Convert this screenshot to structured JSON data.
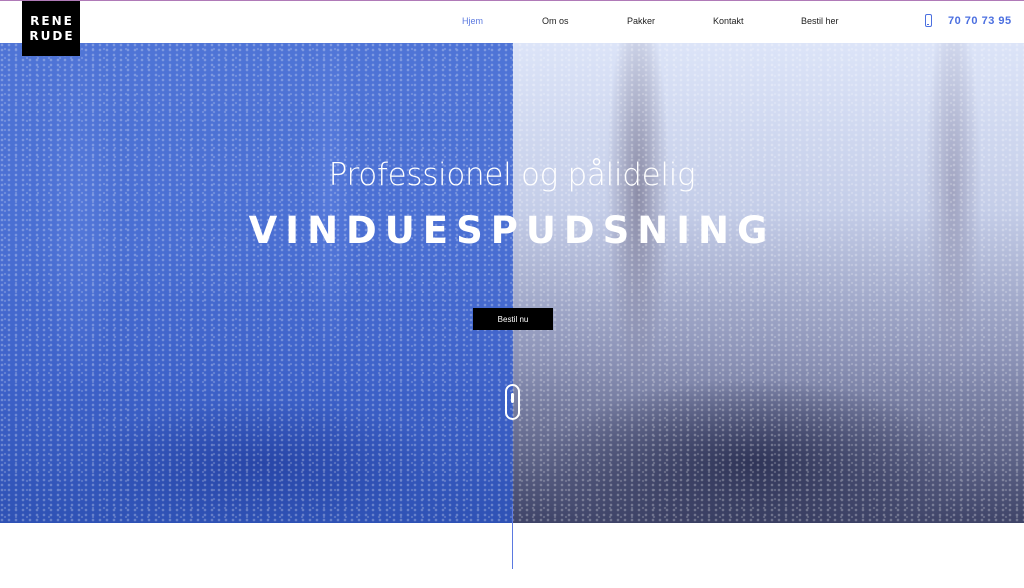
{
  "brand": {
    "logo_line1": "RENE",
    "logo_line2": "RUDE"
  },
  "nav": {
    "items": [
      {
        "label": "Hjem",
        "active": true
      },
      {
        "label": "Om os",
        "active": false
      },
      {
        "label": "Pakker",
        "active": false
      },
      {
        "label": "Kontakt",
        "active": false
      },
      {
        "label": "Bestil her",
        "active": false
      }
    ]
  },
  "phone": {
    "icon": "phone-icon",
    "number": "70 70 73 95"
  },
  "hero": {
    "subtitle": "Professionel og pålidelig",
    "title": "VINDUESPUDSNING",
    "cta_label": "Bestil nu",
    "scroll_icon": "scroll-down-icon"
  },
  "colors": {
    "accent": "#5b79e0",
    "phone": "#4b6fe0",
    "logo_bg": "#000000",
    "cta_bg": "#000000",
    "hero_left": "#4a6fd3",
    "hero_right": "#c4cde8"
  }
}
